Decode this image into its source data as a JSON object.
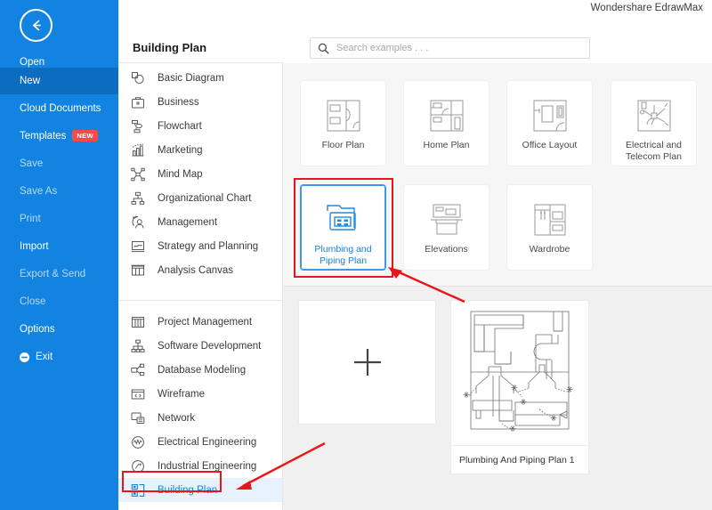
{
  "app": {
    "brand": "Wondershare EdrawMax"
  },
  "sidebar": {
    "back_icon": "back-arrow-icon",
    "items": [
      {
        "label": "Open",
        "state": "normal"
      },
      {
        "label": "New",
        "state": "active"
      },
      {
        "label": "Cloud Documents",
        "state": "normal"
      },
      {
        "label": "Templates",
        "state": "normal",
        "badge": "NEW"
      },
      {
        "label": "Save",
        "state": "dim"
      },
      {
        "label": "Save As",
        "state": "dim"
      },
      {
        "label": "Print",
        "state": "dim"
      },
      {
        "label": "Import",
        "state": "normal"
      },
      {
        "label": "Export & Send",
        "state": "dim"
      },
      {
        "label": "Close",
        "state": "dim"
      },
      {
        "label": "Options",
        "state": "normal"
      },
      {
        "label": "Exit",
        "state": "normal",
        "icon": "exit-icon"
      }
    ]
  },
  "categories": {
    "title": "Building Plan",
    "group_a": [
      {
        "label": "Basic Diagram",
        "icon": "basic-diagram-icon"
      },
      {
        "label": "Business",
        "icon": "briefcase-icon"
      },
      {
        "label": "Flowchart",
        "icon": "flowchart-icon"
      },
      {
        "label": "Marketing",
        "icon": "bar-chart-icon"
      },
      {
        "label": "Mind Map",
        "icon": "mind-map-icon"
      },
      {
        "label": "Organizational Chart",
        "icon": "org-chart-icon"
      },
      {
        "label": "Management",
        "icon": "management-icon"
      },
      {
        "label": "Strategy and Planning",
        "icon": "strategy-icon"
      },
      {
        "label": "Analysis Canvas",
        "icon": "analysis-canvas-icon"
      }
    ],
    "group_b": [
      {
        "label": "Project Management",
        "icon": "project-management-icon"
      },
      {
        "label": "Software Development",
        "icon": "software-development-icon"
      },
      {
        "label": "Database Modeling",
        "icon": "database-modeling-icon"
      },
      {
        "label": "Wireframe",
        "icon": "wireframe-icon"
      },
      {
        "label": "Network",
        "icon": "network-icon"
      },
      {
        "label": "Electrical Engineering",
        "icon": "electrical-engineering-icon"
      },
      {
        "label": "Industrial Engineering",
        "icon": "industrial-engineering-icon"
      },
      {
        "label": "Building Plan",
        "icon": "building-plan-icon",
        "selected": true
      }
    ]
  },
  "search": {
    "placeholder": "Search examples . . .",
    "value": "",
    "icon": "search-icon"
  },
  "types": [
    {
      "label": "Floor Plan",
      "icon": "floor-plan-icon",
      "selected": false
    },
    {
      "label": "Home Plan",
      "icon": "home-plan-icon",
      "selected": false
    },
    {
      "label": "Office Layout",
      "icon": "office-layout-icon",
      "selected": false
    },
    {
      "label": "Electrical and Telecom Plan",
      "icon": "electrical-telecom-icon",
      "selected": false
    },
    {
      "label": "Plumbing and Piping Plan",
      "icon": "plumbing-piping-icon",
      "selected": true
    },
    {
      "label": "Elevations",
      "icon": "elevations-icon",
      "selected": false
    },
    {
      "label": "Wardrobe",
      "icon": "wardrobe-icon",
      "selected": false
    }
  ],
  "documents": {
    "new_blank": {
      "icon": "plus-icon",
      "label": ""
    },
    "items": [
      {
        "name": "Plumbing And Piping Plan 1",
        "thumbnail": "plumbing-piping-plan-thumbnail"
      }
    ]
  },
  "annotations": {
    "highlight_color": "#e8161a",
    "boxes": [
      {
        "target": "plumbing-and-piping-plan-card"
      },
      {
        "target": "building-plan-category"
      }
    ],
    "arrows": [
      {
        "points_to": "plumbing-and-piping-plan-card"
      },
      {
        "points_to": "building-plan-category"
      }
    ]
  },
  "colors": {
    "sidebar_blue": "#1283e0",
    "sidebar_active": "#0c6cc0",
    "accent": "#1283e0",
    "badge_red": "#fc4a4a",
    "annotation_red": "#e8161a"
  }
}
